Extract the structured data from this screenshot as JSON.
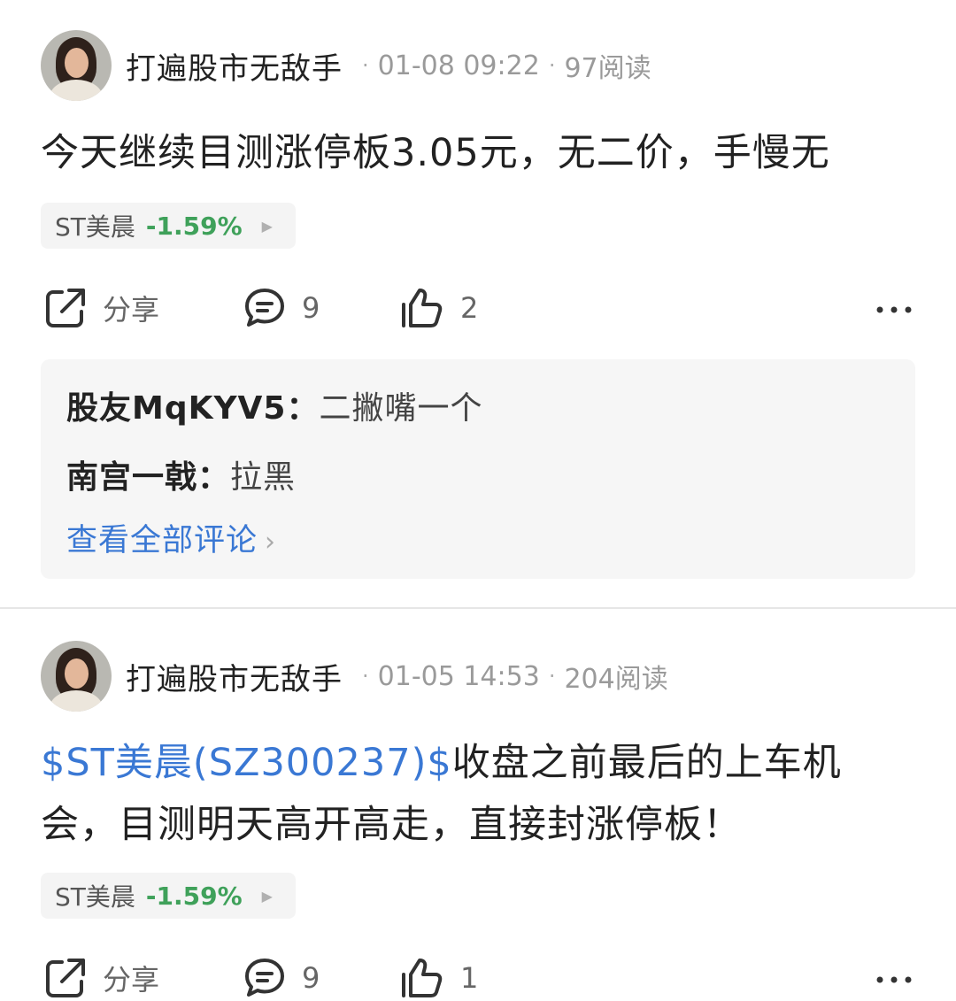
{
  "posts": [
    {
      "author": "打遍股市无敌手",
      "date": "01-08 09:22",
      "reads": "97阅读",
      "content_line1": "今天继续目测涨停板3.05元，无二价，手慢无",
      "stock_tag": {
        "name": "ST美晨",
        "change": "-1.59%"
      },
      "actions": {
        "share_label": "分享",
        "comment_count": "9",
        "like_count": "2"
      },
      "comments": [
        {
          "author": "股友MqKYV5：",
          "text": "二撇嘴一个"
        },
        {
          "author": "南宫一戟：",
          "text": "拉黑"
        }
      ],
      "view_all_comments": "查看全部评论"
    },
    {
      "author": "打遍股市无敌手",
      "date": "01-05 14:53",
      "reads": "204阅读",
      "stock_link": "$ST美晨(SZ300237)$",
      "content_after_link": "收盘之前最后的上车机",
      "content_line2": "会，目测明天高开高走，直接封涨停板！",
      "stock_tag": {
        "name": "ST美晨",
        "change": "-1.59%"
      },
      "actions": {
        "share_label": "分享",
        "comment_count": "9",
        "like_count": "1"
      }
    }
  ],
  "colors": {
    "link_blue": "#3a78d4",
    "change_green": "#3fa15a",
    "meta_gray": "#9a9a9a",
    "tag_bg": "#f4f4f4",
    "comment_bg": "#f6f6f6"
  },
  "icons": [
    "share-icon",
    "comment-icon",
    "thumbs-up-icon",
    "more-icon",
    "chevron-right-icon",
    "triangle-right-icon"
  ]
}
